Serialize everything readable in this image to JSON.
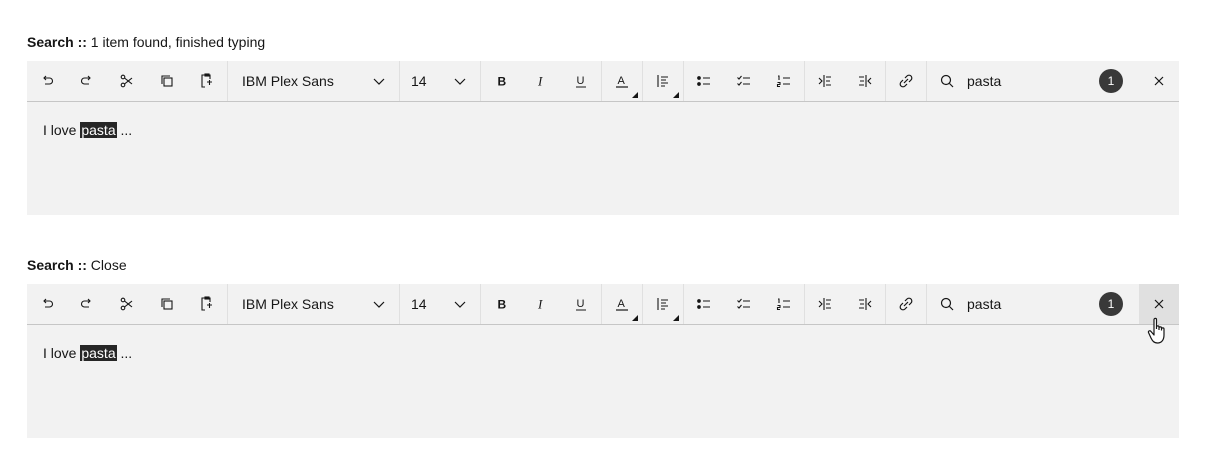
{
  "examples": [
    {
      "caption_bold": "Search ::",
      "caption_rest": " 1 item found, finished typing",
      "font_family": "IBM Plex Sans",
      "font_size": "14",
      "search_query": "pasta",
      "match_count": "1",
      "editor_before": "I love ",
      "editor_match": "pasta",
      "editor_after": " ..."
    },
    {
      "caption_bold": "Search ::",
      "caption_rest": " Close",
      "font_family": "IBM Plex Sans",
      "font_size": "14",
      "search_query": "pasta",
      "match_count": "1",
      "editor_before": "I love ",
      "editor_match": "pasta",
      "editor_after": " ..."
    }
  ],
  "toolbar_icons": [
    "undo-icon",
    "redo-icon",
    "cut-icon",
    "copy-icon",
    "paste-icon",
    "bold-icon",
    "italic-icon",
    "underline-icon",
    "text-color-icon",
    "align-icon",
    "bulleted-list-icon",
    "checklist-icon",
    "numbered-list-icon",
    "indent-icon",
    "outdent-icon",
    "link-icon",
    "search-icon",
    "close-icon"
  ],
  "colors": {
    "toolbar_bg": "#f2f2f2",
    "badge_bg": "#393939",
    "highlight_bg": "#262626",
    "close_hover_bg": "#e0e0e0"
  }
}
